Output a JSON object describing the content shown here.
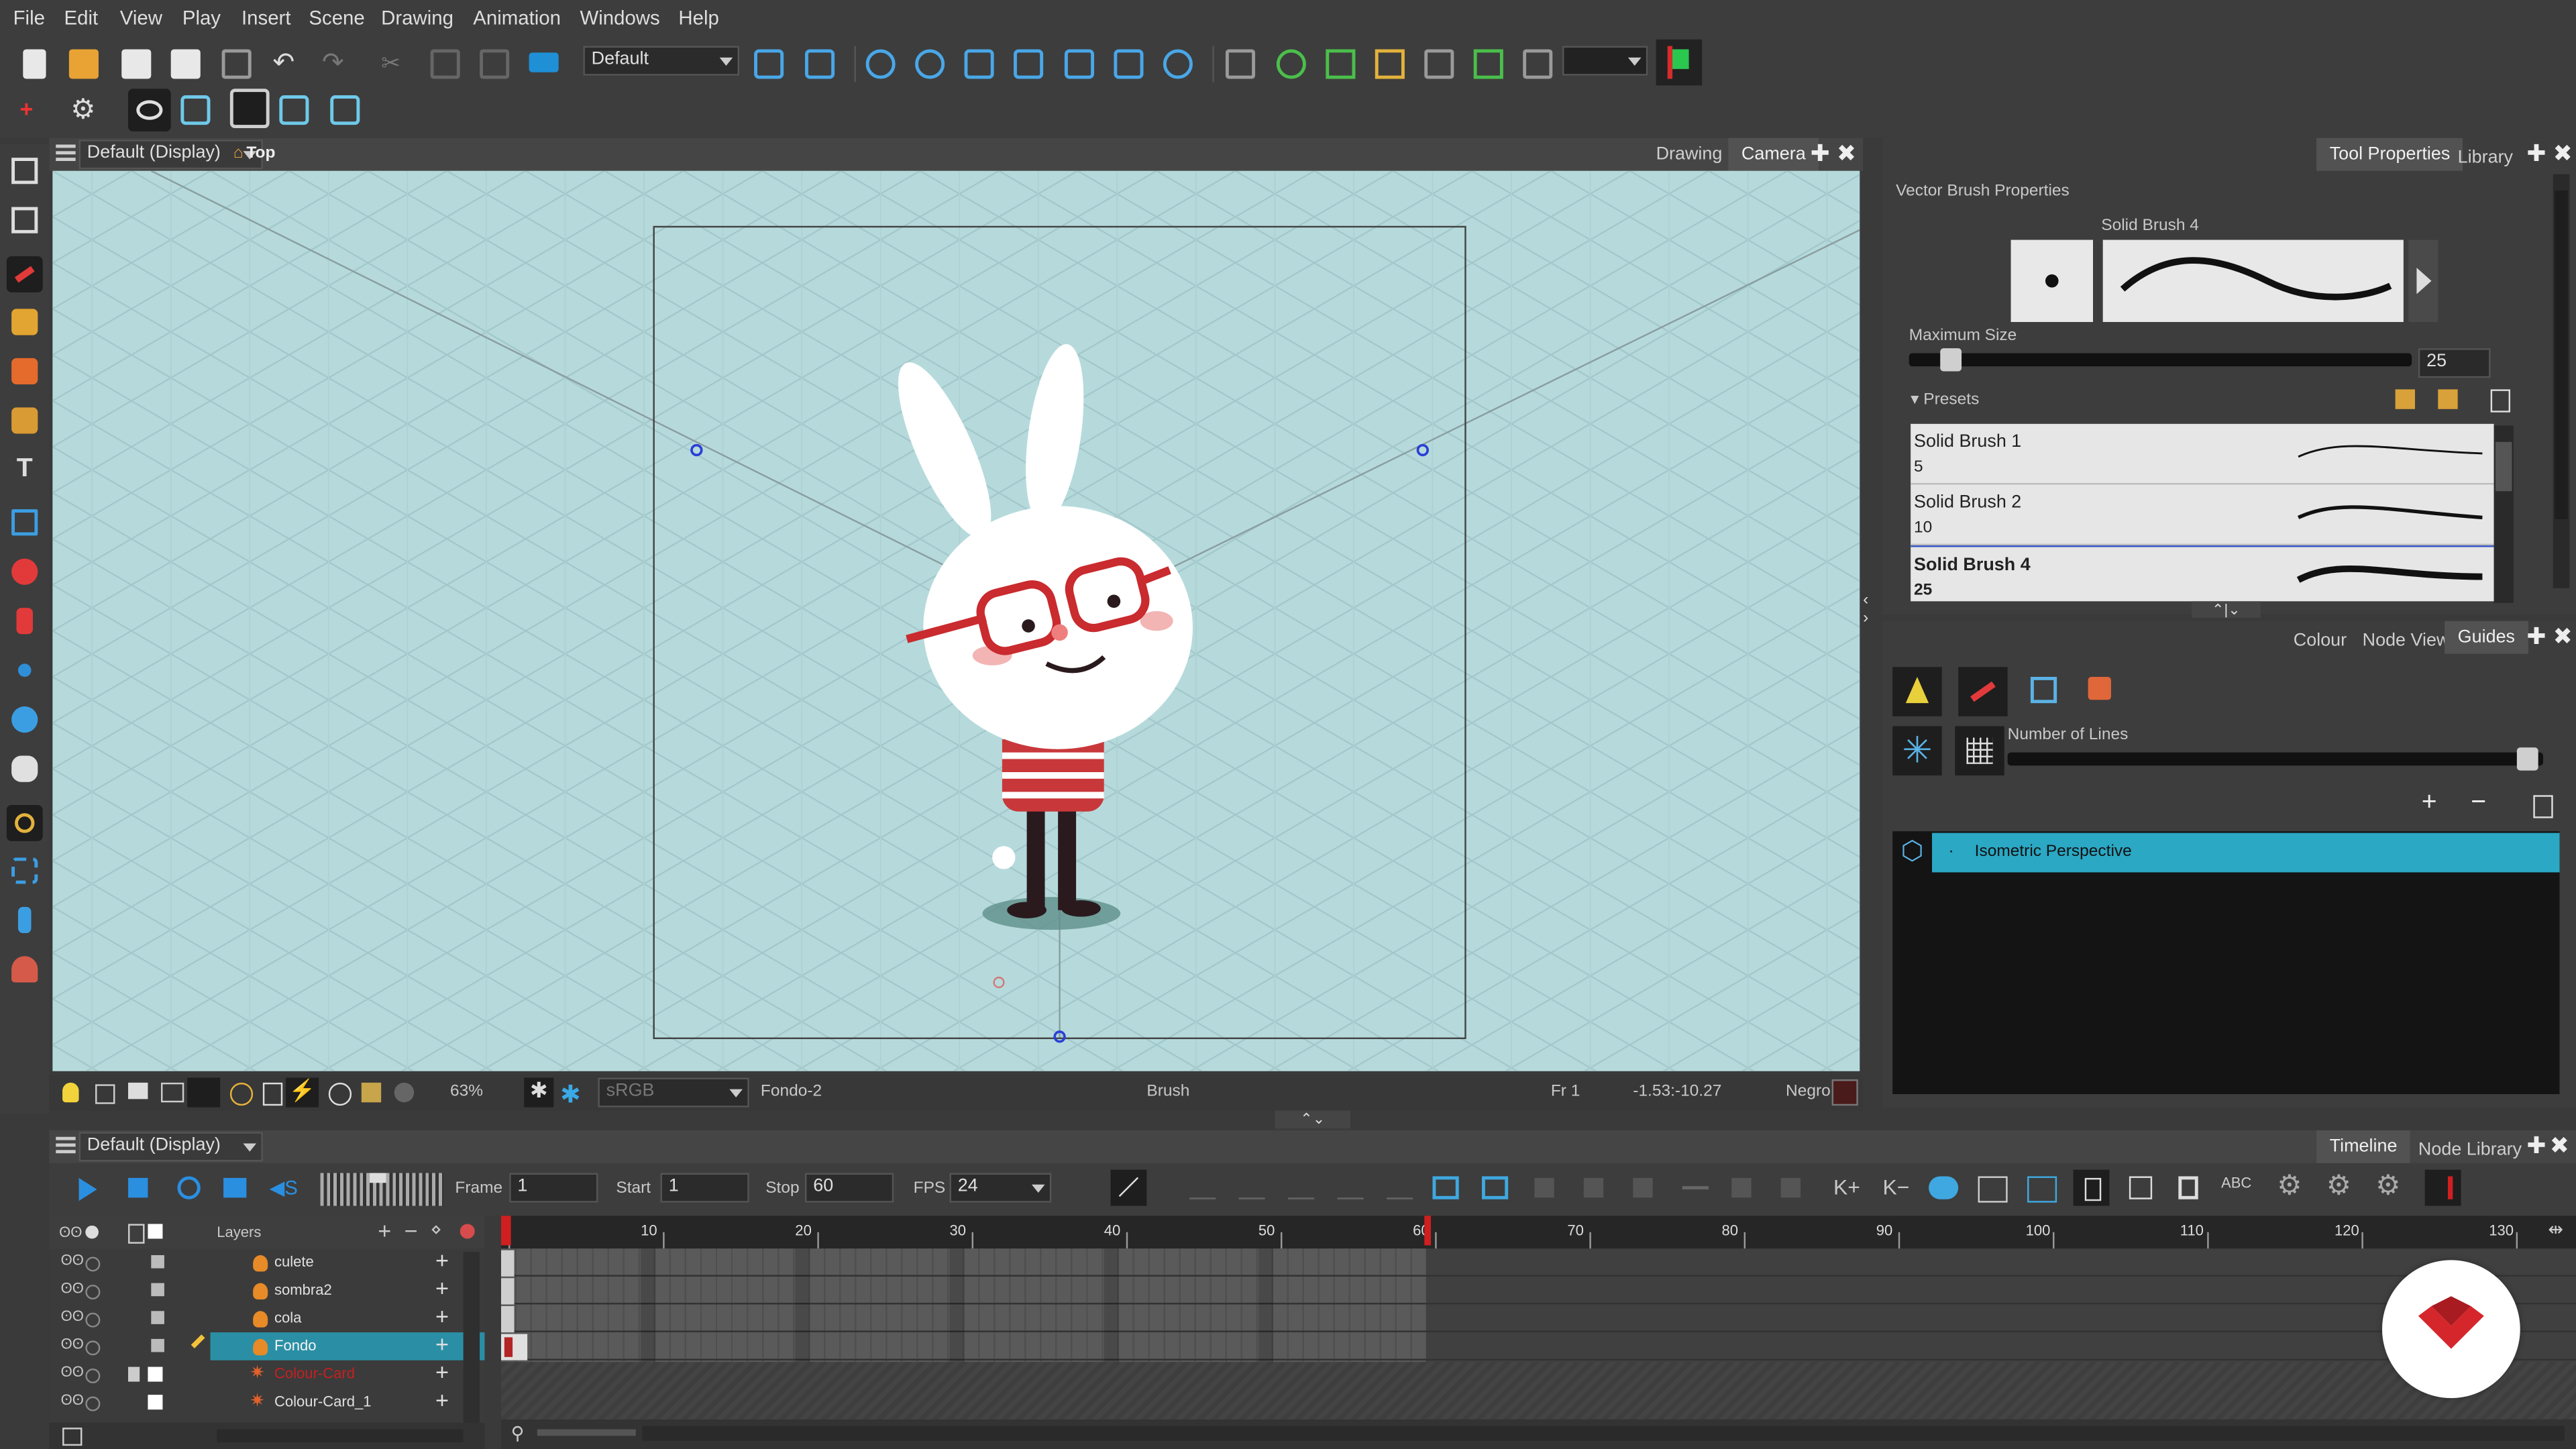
{
  "menu": [
    "File",
    "Edit",
    "View",
    "Play",
    "Insert",
    "Scene",
    "Drawing",
    "Animation",
    "Windows",
    "Help"
  ],
  "toolbar": {
    "workspace": "Default"
  },
  "view": {
    "title": "Default (Display)",
    "top_label": "Top",
    "tabs": [
      "Drawing",
      "Camera"
    ],
    "zoom": "63%",
    "color_space": "sRGB",
    "drawing_name": "Fondo-2",
    "tool_name": "Brush",
    "frame": "Fr 1",
    "coords": "-1.53:-10.27",
    "colour_name": "Negro"
  },
  "tool_properties": {
    "tabs": [
      "Tool Properties",
      "Library"
    ],
    "section": "Vector Brush Properties",
    "brush_name": "Solid Brush 4",
    "max_size_label": "Maximum Size",
    "max_size_value": "25",
    "presets_label": "Presets",
    "presets": [
      {
        "name": "Solid Brush 1",
        "size": "5"
      },
      {
        "name": "Solid Brush 2",
        "size": "10"
      },
      {
        "name": "Solid Brush 4",
        "size": "25"
      }
    ]
  },
  "guides": {
    "tabs": [
      "Colour",
      "Node View",
      "Guides"
    ],
    "lines_label": "Number of Lines",
    "items": [
      "Isometric Perspective"
    ]
  },
  "timeline": {
    "title": "Default (Display)",
    "tabs": [
      "Timeline",
      "Node Library"
    ],
    "frame_label": "Frame",
    "frame_value": "1",
    "start_label": "Start",
    "start_value": "1",
    "stop_label": "Stop",
    "stop_value": "60",
    "fps_label": "FPS",
    "fps_value": "24",
    "layers_label": "Layers",
    "layers": [
      "culete",
      "sombra2",
      "cola",
      "Fondo",
      "Colour-Card",
      "Colour-Card_1"
    ],
    "ruler": [
      "10",
      "20",
      "30",
      "40",
      "50",
      "60",
      "70",
      "80",
      "90",
      "100",
      "110",
      "120",
      "130"
    ]
  },
  "colors": {
    "accent": "#2aa8c4",
    "playhead": "#d01f1f"
  }
}
